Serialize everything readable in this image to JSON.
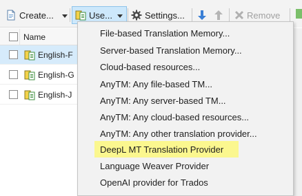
{
  "toolbar": {
    "create_label": "Create...",
    "use_label": "Use...",
    "settings_label": "Settings...",
    "remove_label": "Remove",
    "icons": {
      "create": "new-document-icon",
      "use": "translation-memory-icon",
      "settings": "gear-icon",
      "move_down": "arrow-down-icon",
      "move_up": "arrow-up-icon",
      "remove": "remove-x-icon",
      "dropdown": "caret-down-icon"
    },
    "colors": {
      "use_active_bg": "#cde8fb",
      "arrow_blue": "#3a7fd5",
      "remove_gray": "#a0a0a0"
    }
  },
  "grid": {
    "column_name": "Name",
    "rows": [
      {
        "label": "English-F",
        "selected": true
      },
      {
        "label": "English-G",
        "selected": false
      },
      {
        "label": "English-J",
        "selected": false
      }
    ]
  },
  "menu": {
    "items": [
      {
        "label": "File-based Translation Memory..."
      },
      {
        "label": "Server-based Translation Memory..."
      },
      {
        "label": "Cloud-based resources..."
      },
      {
        "label": "AnyTM: Any file-based TM..."
      },
      {
        "label": "AnyTM: Any server-based TM..."
      },
      {
        "label": "AnyTM: Any cloud-based resources..."
      },
      {
        "label": "AnyTM: Any other translation provider..."
      },
      {
        "label": "DeepL MT Translation Provider",
        "highlighted": true
      },
      {
        "label": "Language Weaver Provider"
      },
      {
        "label": "OpenAI provider for Trados"
      }
    ],
    "highlight_color": "#fbf78f"
  }
}
